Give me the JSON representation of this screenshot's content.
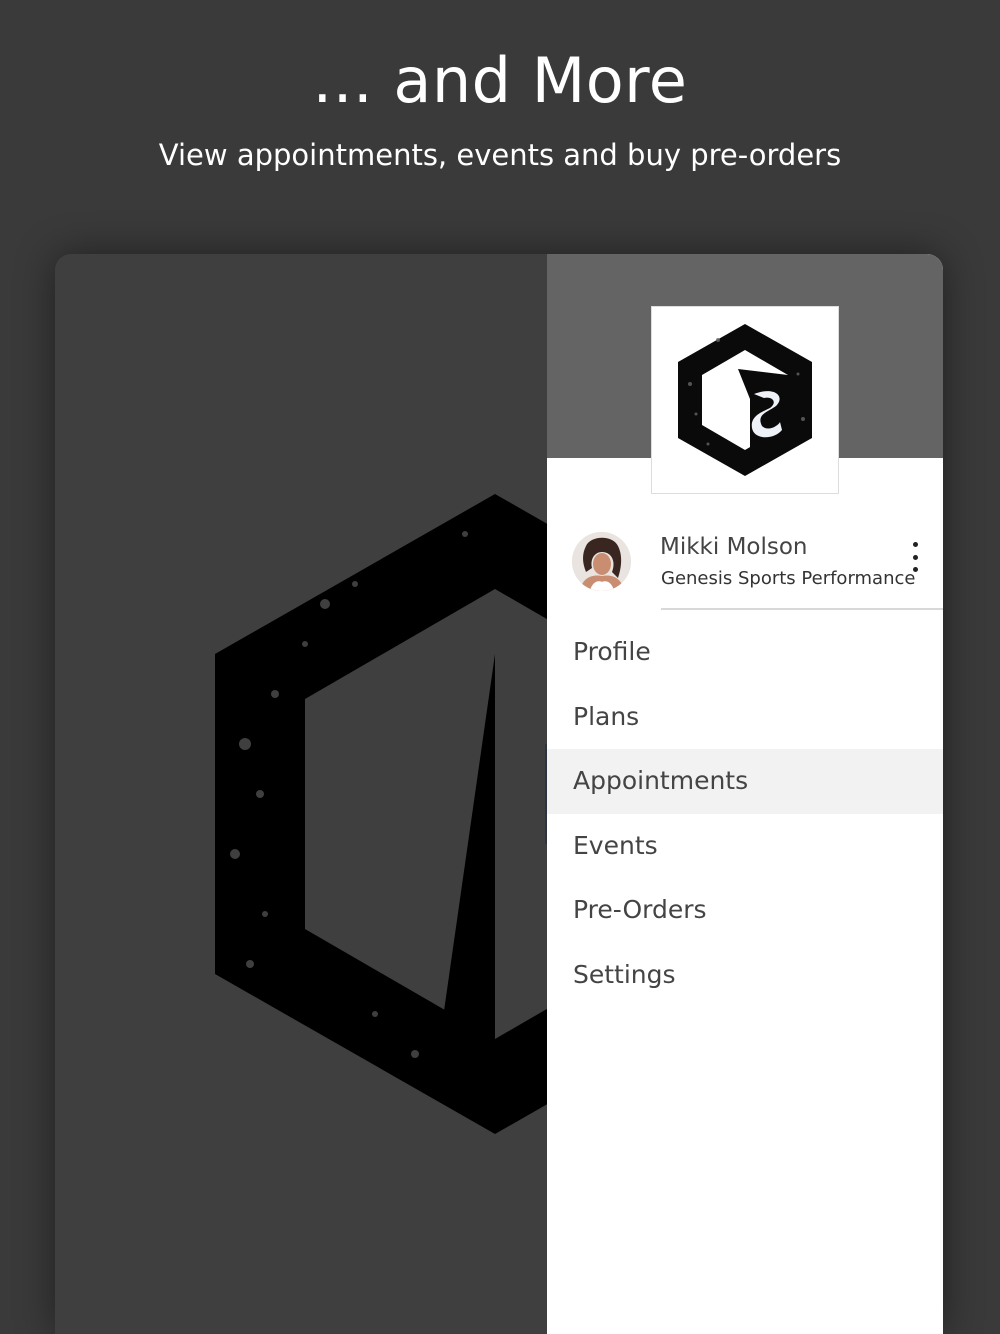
{
  "promo": {
    "headline": "... and More",
    "subline": "View appointments, events and buy pre-orders"
  },
  "drawer": {
    "logo_icon": "genesis-sports-hexagon-logo",
    "user": {
      "name": "Mikki Molson",
      "organization": "Genesis Sports Performance",
      "avatar_icon": "user-avatar-photo",
      "menu_icon": "kebab-menu-icon"
    },
    "menu": [
      {
        "label": "Profile",
        "active": false
      },
      {
        "label": "Plans",
        "active": false
      },
      {
        "label": "Appointments",
        "active": true
      },
      {
        "label": "Events",
        "active": false
      },
      {
        "label": "Pre-Orders",
        "active": false
      },
      {
        "label": "Settings",
        "active": false
      }
    ],
    "active_color": "#f2f2f2",
    "header_color": "#646464"
  },
  "background": {
    "logo_icon": "background-hexagon-logo",
    "color": "#3f3f3f"
  }
}
